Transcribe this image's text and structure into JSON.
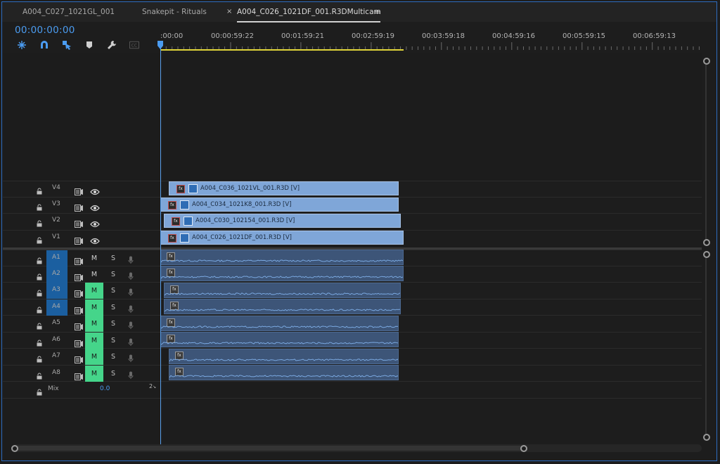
{
  "tabs": [
    {
      "label": "A004_C027_1021GL_001",
      "active": false
    },
    {
      "label": "Snakepit - Rituals",
      "active": false
    },
    {
      "label": "A004_C026_1021DF_001.R3DMulticam",
      "active": true
    }
  ],
  "timecode": "00:00:00:00",
  "toolbar": [
    {
      "icon": "snap-insert-icon"
    },
    {
      "icon": "magnet-icon"
    },
    {
      "icon": "linked-selection-icon"
    },
    {
      "icon": "marker-icon"
    },
    {
      "icon": "wrench-icon"
    },
    {
      "icon": "captions-icon"
    }
  ],
  "ruler": {
    "labels": [
      ":00:00",
      "00:00:59:22",
      "00:01:59:21",
      "00:02:59:19",
      "00:03:59:18",
      "00:04:59:16",
      "00:05:59:15",
      "00:06:59:13"
    ]
  },
  "video_tracks": [
    {
      "name": "V4",
      "clip": "A004_C036_1021VL_001.R3D [V]"
    },
    {
      "name": "V3",
      "clip": "A004_C034_1021K8_001.R3D [V]"
    },
    {
      "name": "V2",
      "clip": "A004_C030_102154_001.R3D [V]"
    },
    {
      "name": "V1",
      "clip": "A004_C026_1021DF_001.R3D [V]"
    }
  ],
  "audio_tracks": [
    {
      "name": "A1",
      "m": "M",
      "s": "S",
      "target": true,
      "muted": false
    },
    {
      "name": "A2",
      "m": "M",
      "s": "S",
      "target": true,
      "muted": false
    },
    {
      "name": "A3",
      "m": "M",
      "s": "S",
      "target": true,
      "muted": true
    },
    {
      "name": "A4",
      "m": "M",
      "s": "S",
      "target": true,
      "muted": true
    },
    {
      "name": "A5",
      "m": "M",
      "s": "S",
      "target": false,
      "muted": true
    },
    {
      "name": "A6",
      "m": "M",
      "s": "S",
      "target": false,
      "muted": true
    },
    {
      "name": "A7",
      "m": "M",
      "s": "S",
      "target": false,
      "muted": true
    },
    {
      "name": "A8",
      "m": "M",
      "s": "S",
      "target": false,
      "muted": true
    }
  ],
  "mix": {
    "label": "Mix",
    "value": "0.0",
    "channel": "2"
  },
  "colors": {
    "accent": "#4b9cf1",
    "clip_video": "#7fa6d8",
    "clip_audio": "#3d5578",
    "mute_on": "#45d58a",
    "target": "#1b5fa0",
    "inout": "#e0d438"
  }
}
